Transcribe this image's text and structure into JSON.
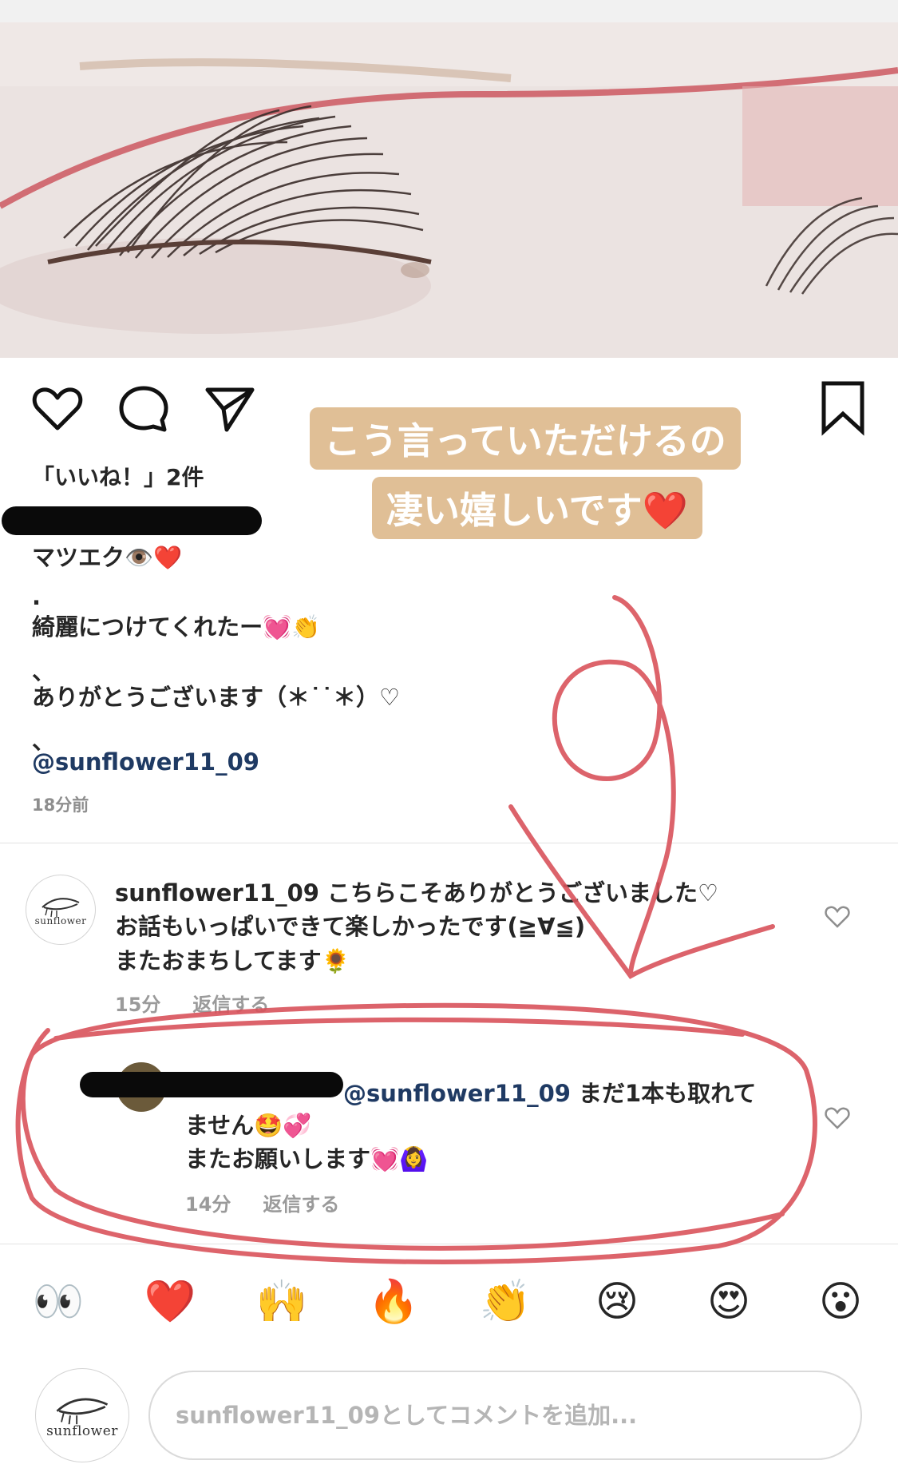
{
  "post": {
    "likes_text": "「いいね！」2件",
    "caption_lines": [
      "マツエク👁️❤️",
      ".",
      "綺麗につけてくれたー💓👏",
      "、",
      "ありがとうございます（＊˙˙＊）♡",
      "、"
    ],
    "caption_mention": "@sunflower11_09",
    "time": "18分前"
  },
  "story_label": {
    "line1": "こう言っていただけるの",
    "line2": "凄い嬉しいです❤️"
  },
  "comments": [
    {
      "username": "sunflower11_09",
      "line1": " こちらこそありがとうございました♡",
      "line2": "お話もいっぱいできて楽しかったです(≧∀≦)",
      "line3": "またおまちしてます🌻",
      "time": "15分",
      "reply": "返信する",
      "avatar_text": "sunflower"
    },
    {
      "mention": "@sunflower11_09",
      "line1_rest": " まだ1本も取れて",
      "line2": "ません🤩💞",
      "line3": "またお願いします💓🙆‍♀️",
      "time": "14分",
      "reply": "返信する"
    }
  ],
  "emoji_bar": [
    "👀",
    "❤️",
    "🙌",
    "🔥",
    "👏",
    "😢",
    "😍",
    "😮"
  ],
  "comment_input": {
    "placeholder": "sunflower11_09としてコメントを追加...",
    "avatar_text": "sunflower"
  },
  "colors": {
    "mention": "#1f3a63",
    "label_bg": "#e0bf96",
    "annotation": "#d9535b"
  }
}
